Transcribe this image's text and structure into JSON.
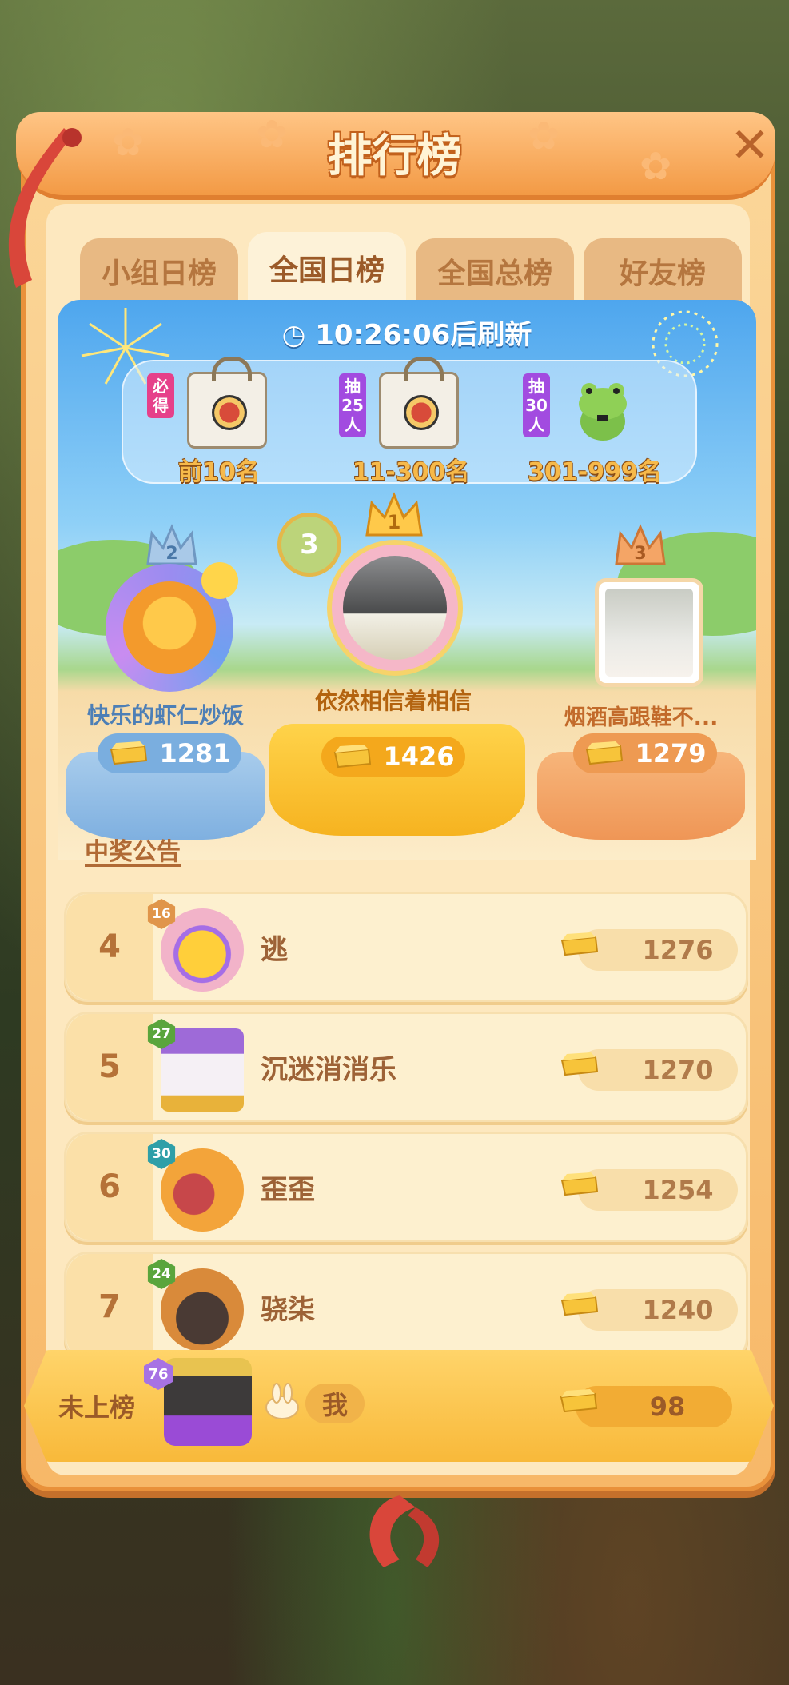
{
  "title": "排行榜",
  "tabs": [
    {
      "label": "小组日榜",
      "active": false
    },
    {
      "label": "全国日榜",
      "active": true
    },
    {
      "label": "全国总榜",
      "active": false
    },
    {
      "label": "好友榜",
      "active": false
    }
  ],
  "timer": "10:26:06后刷新",
  "rewards": [
    {
      "tag": "必得",
      "tag_color": "#e6408a",
      "prize": "tote-bag",
      "range": "前10名"
    },
    {
      "tag": "抽25人",
      "tag_color": "#a24be0",
      "prize": "tote-bag",
      "range": "11-300名"
    },
    {
      "tag": "抽30人",
      "tag_color": "#a24be0",
      "prize": "frog-plush",
      "range": "301-999名"
    }
  ],
  "podium": {
    "first": {
      "rank": "1",
      "name": "依然相信着相信",
      "score": "1426",
      "badge_level": "3"
    },
    "second": {
      "rank": "2",
      "name": "快乐的虾仁炒饭",
      "score": "1281"
    },
    "third": {
      "rank": "3",
      "name": "烟酒高跟鞋不...",
      "score": "1279"
    }
  },
  "announcement": "中奖公告",
  "rows": [
    {
      "rank": "4",
      "level": "16",
      "level_color": "#e0954a",
      "name": "逃",
      "score": "1276"
    },
    {
      "rank": "5",
      "level": "27",
      "level_color": "#5aa53c",
      "name": "沉迷消消乐",
      "score": "1270"
    },
    {
      "rank": "6",
      "level": "30",
      "level_color": "#2f9fa8",
      "name": "歪歪",
      "score": "1254"
    },
    {
      "rank": "7",
      "level": "24",
      "level_color": "#5aa53c",
      "name": "骁柒",
      "score": "1240"
    }
  ],
  "me": {
    "rank_label": "未上榜",
    "level": "76",
    "name": "我",
    "score": "98"
  },
  "colors": {
    "accent": "#f39a45",
    "gold": "#f6b94a",
    "row_bg": "#fdf0cf"
  }
}
